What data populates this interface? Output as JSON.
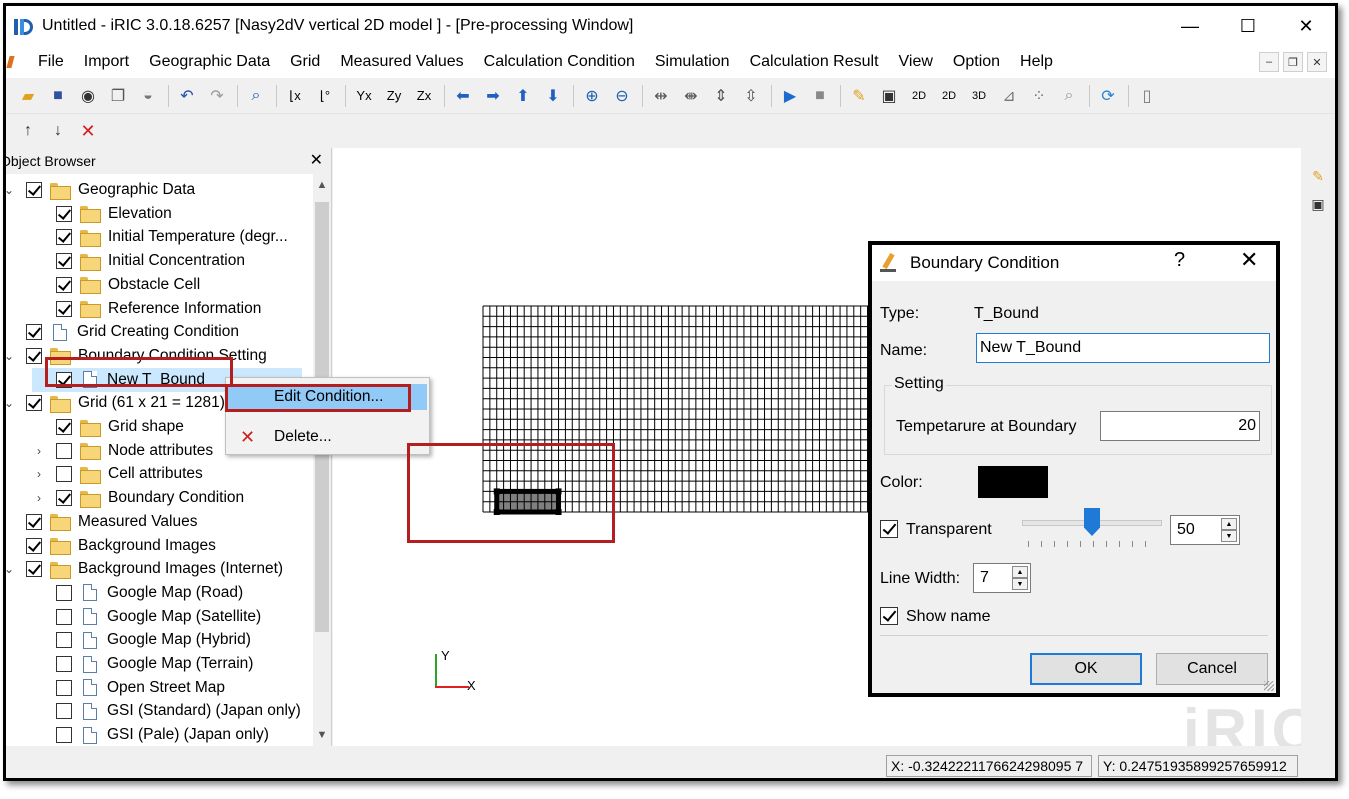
{
  "window": {
    "title": "Untitled - iRIC 3.0.18.6257 [Nasy2dV vertical 2D model ] - [Pre-processing Window]",
    "minimize": "—",
    "maximize": "☐",
    "close": "✕"
  },
  "menu": [
    "File",
    "Import",
    "Geographic Data",
    "Grid",
    "Measured Values",
    "Calculation Condition",
    "Simulation",
    "Calculation Result",
    "View",
    "Option",
    "Help"
  ],
  "object_browser": {
    "title": "Object Browser",
    "items": [
      {
        "label": "Geographic Data",
        "checked": true,
        "icon": "folder-icon",
        "level": 0,
        "expander": "⌄"
      },
      {
        "label": "Elevation",
        "checked": true,
        "icon": "folder-icon",
        "level": 1
      },
      {
        "label": "Initial Temperature (degr...",
        "checked": true,
        "icon": "folder-icon",
        "level": 1
      },
      {
        "label": "Initial Concentration",
        "checked": true,
        "icon": "folder-icon",
        "level": 1
      },
      {
        "label": "Obstacle Cell",
        "checked": true,
        "icon": "folder-icon",
        "level": 1
      },
      {
        "label": "Reference Information",
        "checked": true,
        "icon": "folder-icon",
        "level": 1
      },
      {
        "label": "Grid Creating Condition",
        "checked": true,
        "icon": "document-icon",
        "level": 0
      },
      {
        "label": "Boundary Condition Setting",
        "checked": true,
        "icon": "folder-icon",
        "level": 0,
        "expander": "⌄"
      },
      {
        "label": "New T_Bound",
        "checked": true,
        "icon": "document-icon",
        "level": 1,
        "selected": true
      },
      {
        "label": "Grid (61 x 21 = 1281)",
        "checked": true,
        "icon": "folder-icon",
        "level": 0,
        "expander": "⌄"
      },
      {
        "label": "Grid shape",
        "checked": true,
        "icon": "folder-icon",
        "level": 1
      },
      {
        "label": "Node attributes",
        "checked": false,
        "icon": "folder-icon",
        "level": 1,
        "expander": "›"
      },
      {
        "label": "Cell attributes",
        "checked": false,
        "icon": "folder-icon",
        "level": 1,
        "expander": "›"
      },
      {
        "label": "Boundary Condition",
        "checked": true,
        "icon": "folder-icon",
        "level": 1,
        "expander": "›"
      },
      {
        "label": "Measured Values",
        "checked": true,
        "icon": "folder-icon",
        "level": 0
      },
      {
        "label": "Background Images",
        "checked": true,
        "icon": "folder-icon",
        "level": 0
      },
      {
        "label": "Background Images (Internet)",
        "checked": true,
        "icon": "folder-icon",
        "level": 0,
        "expander": "⌄"
      },
      {
        "label": "Google Map (Road)",
        "checked": false,
        "icon": "document-icon",
        "level": 1
      },
      {
        "label": "Google Map (Satellite)",
        "checked": false,
        "icon": "document-icon",
        "level": 1
      },
      {
        "label": "Google Map (Hybrid)",
        "checked": false,
        "icon": "document-icon",
        "level": 1
      },
      {
        "label": "Google Map (Terrain)",
        "checked": false,
        "icon": "document-icon",
        "level": 1
      },
      {
        "label": "Open Street Map",
        "checked": false,
        "icon": "document-icon",
        "level": 1
      },
      {
        "label": "GSI (Standard) (Japan only)",
        "checked": false,
        "icon": "document-icon",
        "level": 1
      },
      {
        "label": "GSI (Pale) (Japan only)",
        "checked": false,
        "icon": "document-icon",
        "level": 1
      }
    ]
  },
  "context_menu": {
    "edit": "Edit Condition...",
    "delete": "Delete..."
  },
  "canvas": {
    "grid_cols": 60,
    "grid_rows": 20,
    "axis_y": "Y",
    "axis_x": "X",
    "watermark": "iRIC"
  },
  "status": {
    "x": "X: -0.3242221176624298095 7",
    "y": "Y: 0.24751935899257659912"
  },
  "dialog": {
    "title": "Boundary Condition",
    "help": "?",
    "close": "✕",
    "type_label": "Type:",
    "type_value": "T_Bound",
    "name_label": "Name:",
    "name_value": "New T_Bound",
    "setting_label": "Setting",
    "temp_label": "Tempetarure at Boundary",
    "temp_value": "20",
    "color_label": "Color:",
    "color_value": "#000000",
    "transparent_label": "Transparent",
    "transparent_checked": true,
    "transparency": 50,
    "transparency_label": "50",
    "line_width_label": "Line Width:",
    "line_width": "7",
    "show_name_label": "Show name",
    "show_name_checked": true,
    "ok": "OK",
    "cancel": "Cancel"
  },
  "colors": {
    "annotation": "#b41e1e",
    "selection": "#cce8ff",
    "menu_highlight": "#91c9f7",
    "accent": "#1e7ad6"
  }
}
